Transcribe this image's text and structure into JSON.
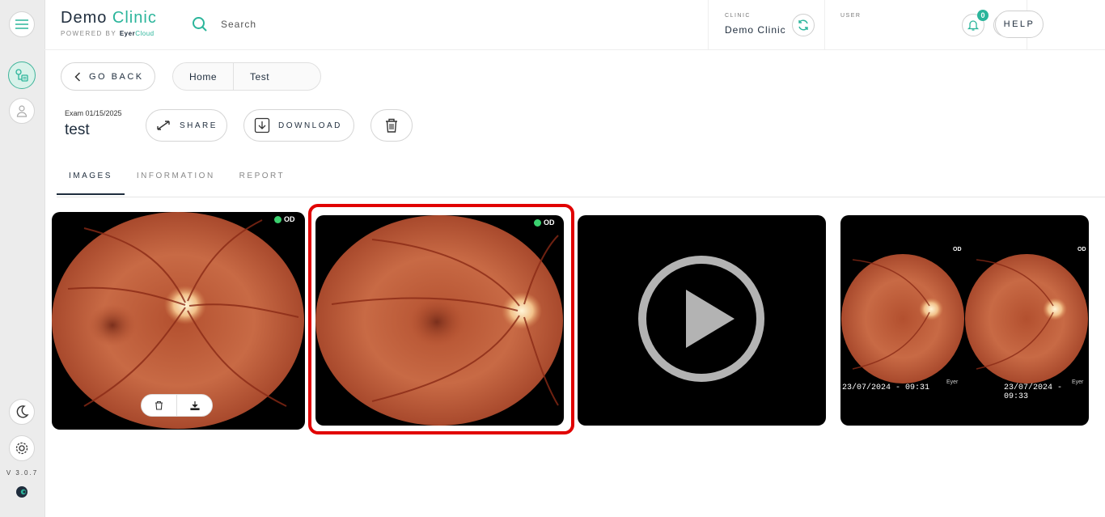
{
  "sidebar": {
    "version": "V 3.0.7"
  },
  "header": {
    "brand_main": "Demo",
    "brand_accent": "Clinic",
    "powered_by": "POWERED BY",
    "brand_small_a": "Eyer",
    "brand_small_b": "Cloud",
    "search_placeholder": "Search",
    "clinic_caption": "CLINIC",
    "clinic_name": "Demo Clinic",
    "user_caption": "USER",
    "notification_count": "0",
    "help_label": "HELP"
  },
  "nav": {
    "go_back_label": "GO BACK",
    "breadcrumbs": [
      "Home",
      "Test"
    ]
  },
  "exam": {
    "date_label": "Exam 01/15/2025",
    "name": "test",
    "share_label": "SHARE",
    "download_label": "DOWNLOAD"
  },
  "tabs": [
    {
      "label": "IMAGES",
      "active": true
    },
    {
      "label": "INFORMATION",
      "active": false
    },
    {
      "label": "REPORT",
      "active": false
    }
  ],
  "images": [
    {
      "eye": "OD",
      "type": "fundus"
    },
    {
      "eye": "OD",
      "type": "fundus",
      "selected": true
    },
    {
      "type": "video"
    },
    {
      "type": "composite",
      "left_eye_label": "OD",
      "right_eye_label": "OD",
      "left_timestamp": "23/07/2024 - 09:31",
      "right_timestamp": "23/07/2024 - 09:33",
      "watermark": "Eyer"
    }
  ],
  "colors": {
    "accent": "#2bb59b",
    "selection": "#e10000",
    "status_dot": "#3bd16f"
  }
}
